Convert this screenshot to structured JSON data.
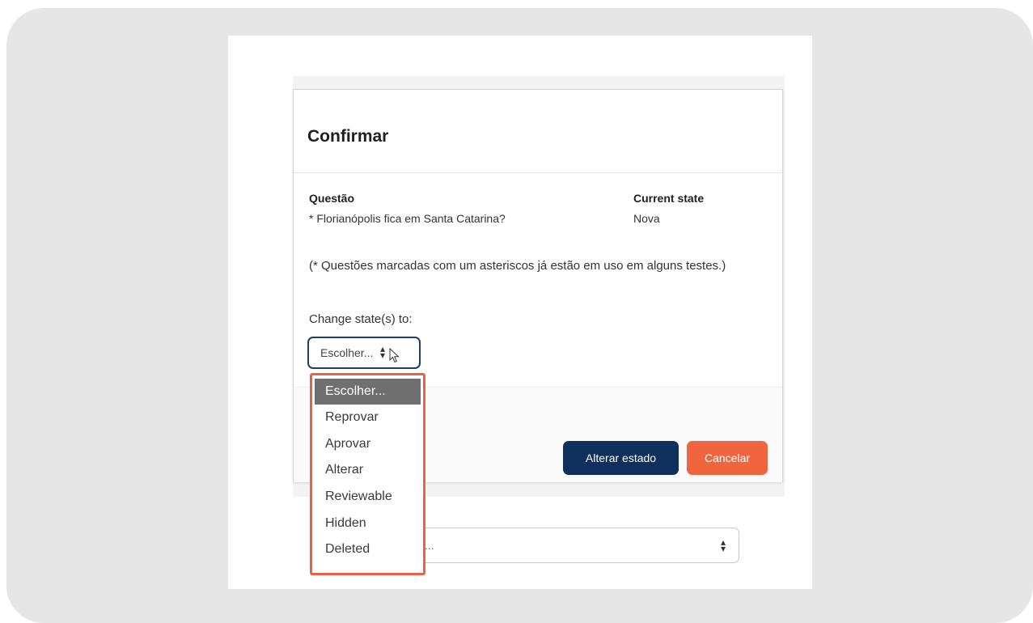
{
  "colors": {
    "primary_button": "#0f2f5c",
    "cancel_button": "#f0653d",
    "dropdown_border": "#e96245",
    "selected_option": "#6f6f6f",
    "select_focus_border": "#1f3d65"
  },
  "modal": {
    "title": "Confirmar",
    "question_header": "Questão",
    "question_value": "* Florianópolis fica em Santa Catarina?",
    "state_header": "Current state",
    "state_value": "Nova",
    "note": "(* Questões marcadas com um asteriscos já estão em uso em alguns testes.)",
    "change_label": "Change state(s) to:",
    "select_value": "Escolher...",
    "select_icon": "up-down-arrows-icon",
    "confirm_button": "Alterar estado",
    "cancel_button": "Cancelar"
  },
  "dropdown": {
    "selected": "Escolher...",
    "options": [
      "Escolher...",
      "Reprovar",
      "Aprovar",
      "Alterar",
      "Reviewable",
      "Hidden",
      "Deleted"
    ]
  },
  "background": {
    "select_text": "..."
  }
}
